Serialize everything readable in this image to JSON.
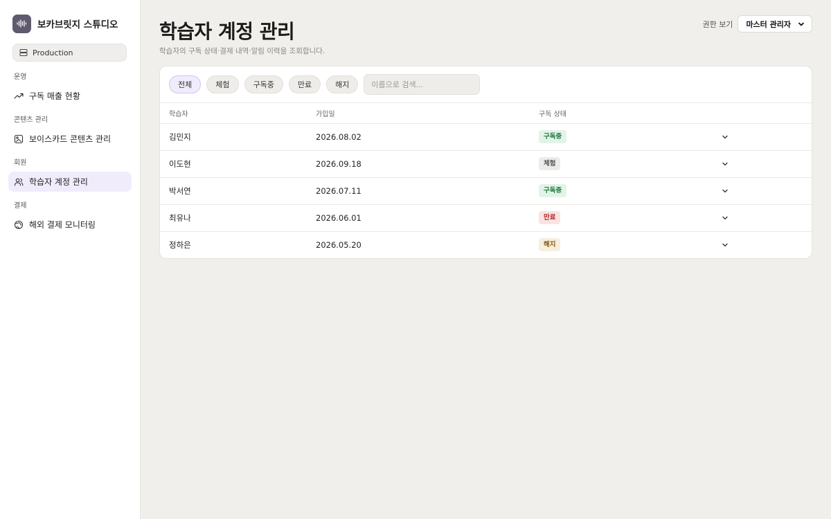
{
  "brand": {
    "name": "보카브릿지 스튜디오",
    "logo_icon": "waveform-icon"
  },
  "environment": {
    "label": "Production",
    "icon": "server-icon"
  },
  "nav": {
    "groups": [
      {
        "title": "운영",
        "items": [
          {
            "label": "구독 매출 현황",
            "icon": "trending-up-icon"
          }
        ]
      },
      {
        "title": "콘텐츠 관리",
        "items": [
          {
            "label": "보이스카드 콘텐츠 관리",
            "icon": "card-image-icon"
          }
        ]
      },
      {
        "title": "회원",
        "items": [
          {
            "label": "학습자 계정 관리",
            "icon": "users-icon",
            "active": true
          }
        ]
      },
      {
        "title": "결제",
        "items": [
          {
            "label": "해외 결제 모니터링",
            "icon": "globe-icon"
          }
        ]
      }
    ]
  },
  "header": {
    "title": "학습자 계정 관리",
    "subtitle": "학습자의 구독 상태·결제 내역·알림 이력을 조회합니다.",
    "role_label": "권한 보기",
    "role_value": "마스터 관리자"
  },
  "filters": {
    "chips": [
      "전체",
      "체험",
      "구독중",
      "만료",
      "해지"
    ],
    "active": "전체",
    "search_placeholder": "이름으로 검색...",
    "search_value": ""
  },
  "table": {
    "columns": [
      "학습자",
      "가입일",
      "구독 상태"
    ],
    "rows": [
      {
        "name": "김민지",
        "joined": "2026.08.02",
        "status": "구독중",
        "status_key": "subscribed"
      },
      {
        "name": "이도현",
        "joined": "2026.09.18",
        "status": "체험",
        "status_key": "trial"
      },
      {
        "name": "박서연",
        "joined": "2026.07.11",
        "status": "구독중",
        "status_key": "subscribed"
      },
      {
        "name": "최유나",
        "joined": "2026.06.01",
        "status": "만료",
        "status_key": "expired"
      },
      {
        "name": "정하은",
        "joined": "2026.05.20",
        "status": "해지",
        "status_key": "cancelled"
      }
    ]
  },
  "colors": {
    "accent_soft": "#f0ecfb",
    "subscribed": "#1f7a3d",
    "trial": "#555555",
    "expired": "#b42b2b",
    "cancelled": "#8a5a17"
  }
}
